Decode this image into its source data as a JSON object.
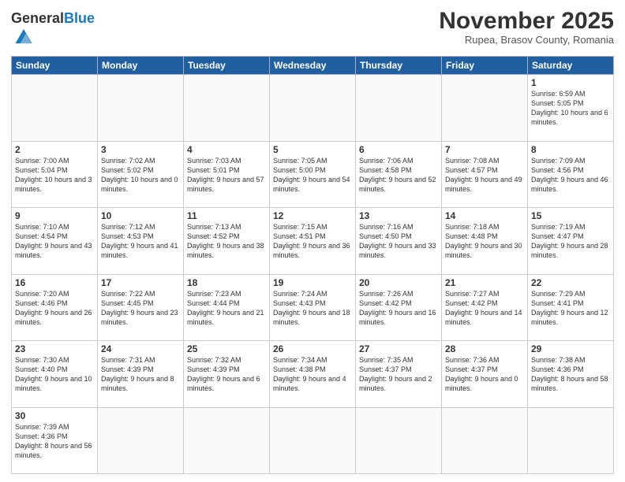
{
  "header": {
    "logo_general": "General",
    "logo_blue": "Blue",
    "title": "November 2025",
    "subtitle": "Rupea, Brasov County, Romania"
  },
  "weekdays": [
    "Sunday",
    "Monday",
    "Tuesday",
    "Wednesday",
    "Thursday",
    "Friday",
    "Saturday"
  ],
  "weeks": [
    [
      {
        "day": "",
        "info": ""
      },
      {
        "day": "",
        "info": ""
      },
      {
        "day": "",
        "info": ""
      },
      {
        "day": "",
        "info": ""
      },
      {
        "day": "",
        "info": ""
      },
      {
        "day": "",
        "info": ""
      },
      {
        "day": "1",
        "info": "Sunrise: 6:59 AM\nSunset: 5:05 PM\nDaylight: 10 hours and 6 minutes."
      }
    ],
    [
      {
        "day": "2",
        "info": "Sunrise: 7:00 AM\nSunset: 5:04 PM\nDaylight: 10 hours and 3 minutes."
      },
      {
        "day": "3",
        "info": "Sunrise: 7:02 AM\nSunset: 5:02 PM\nDaylight: 10 hours and 0 minutes."
      },
      {
        "day": "4",
        "info": "Sunrise: 7:03 AM\nSunset: 5:01 PM\nDaylight: 9 hours and 57 minutes."
      },
      {
        "day": "5",
        "info": "Sunrise: 7:05 AM\nSunset: 5:00 PM\nDaylight: 9 hours and 54 minutes."
      },
      {
        "day": "6",
        "info": "Sunrise: 7:06 AM\nSunset: 4:58 PM\nDaylight: 9 hours and 52 minutes."
      },
      {
        "day": "7",
        "info": "Sunrise: 7:08 AM\nSunset: 4:57 PM\nDaylight: 9 hours and 49 minutes."
      },
      {
        "day": "8",
        "info": "Sunrise: 7:09 AM\nSunset: 4:56 PM\nDaylight: 9 hours and 46 minutes."
      }
    ],
    [
      {
        "day": "9",
        "info": "Sunrise: 7:10 AM\nSunset: 4:54 PM\nDaylight: 9 hours and 43 minutes."
      },
      {
        "day": "10",
        "info": "Sunrise: 7:12 AM\nSunset: 4:53 PM\nDaylight: 9 hours and 41 minutes."
      },
      {
        "day": "11",
        "info": "Sunrise: 7:13 AM\nSunset: 4:52 PM\nDaylight: 9 hours and 38 minutes."
      },
      {
        "day": "12",
        "info": "Sunrise: 7:15 AM\nSunset: 4:51 PM\nDaylight: 9 hours and 36 minutes."
      },
      {
        "day": "13",
        "info": "Sunrise: 7:16 AM\nSunset: 4:50 PM\nDaylight: 9 hours and 33 minutes."
      },
      {
        "day": "14",
        "info": "Sunrise: 7:18 AM\nSunset: 4:48 PM\nDaylight: 9 hours and 30 minutes."
      },
      {
        "day": "15",
        "info": "Sunrise: 7:19 AM\nSunset: 4:47 PM\nDaylight: 9 hours and 28 minutes."
      }
    ],
    [
      {
        "day": "16",
        "info": "Sunrise: 7:20 AM\nSunset: 4:46 PM\nDaylight: 9 hours and 26 minutes."
      },
      {
        "day": "17",
        "info": "Sunrise: 7:22 AM\nSunset: 4:45 PM\nDaylight: 9 hours and 23 minutes."
      },
      {
        "day": "18",
        "info": "Sunrise: 7:23 AM\nSunset: 4:44 PM\nDaylight: 9 hours and 21 minutes."
      },
      {
        "day": "19",
        "info": "Sunrise: 7:24 AM\nSunset: 4:43 PM\nDaylight: 9 hours and 18 minutes."
      },
      {
        "day": "20",
        "info": "Sunrise: 7:26 AM\nSunset: 4:42 PM\nDaylight: 9 hours and 16 minutes."
      },
      {
        "day": "21",
        "info": "Sunrise: 7:27 AM\nSunset: 4:42 PM\nDaylight: 9 hours and 14 minutes."
      },
      {
        "day": "22",
        "info": "Sunrise: 7:29 AM\nSunset: 4:41 PM\nDaylight: 9 hours and 12 minutes."
      }
    ],
    [
      {
        "day": "23",
        "info": "Sunrise: 7:30 AM\nSunset: 4:40 PM\nDaylight: 9 hours and 10 minutes."
      },
      {
        "day": "24",
        "info": "Sunrise: 7:31 AM\nSunset: 4:39 PM\nDaylight: 9 hours and 8 minutes."
      },
      {
        "day": "25",
        "info": "Sunrise: 7:32 AM\nSunset: 4:39 PM\nDaylight: 9 hours and 6 minutes."
      },
      {
        "day": "26",
        "info": "Sunrise: 7:34 AM\nSunset: 4:38 PM\nDaylight: 9 hours and 4 minutes."
      },
      {
        "day": "27",
        "info": "Sunrise: 7:35 AM\nSunset: 4:37 PM\nDaylight: 9 hours and 2 minutes."
      },
      {
        "day": "28",
        "info": "Sunrise: 7:36 AM\nSunset: 4:37 PM\nDaylight: 9 hours and 0 minutes."
      },
      {
        "day": "29",
        "info": "Sunrise: 7:38 AM\nSunset: 4:36 PM\nDaylight: 8 hours and 58 minutes."
      }
    ],
    [
      {
        "day": "30",
        "info": "Sunrise: 7:39 AM\nSunset: 4:36 PM\nDaylight: 8 hours and 56 minutes."
      },
      {
        "day": "",
        "info": ""
      },
      {
        "day": "",
        "info": ""
      },
      {
        "day": "",
        "info": ""
      },
      {
        "day": "",
        "info": ""
      },
      {
        "day": "",
        "info": ""
      },
      {
        "day": "",
        "info": ""
      }
    ]
  ]
}
